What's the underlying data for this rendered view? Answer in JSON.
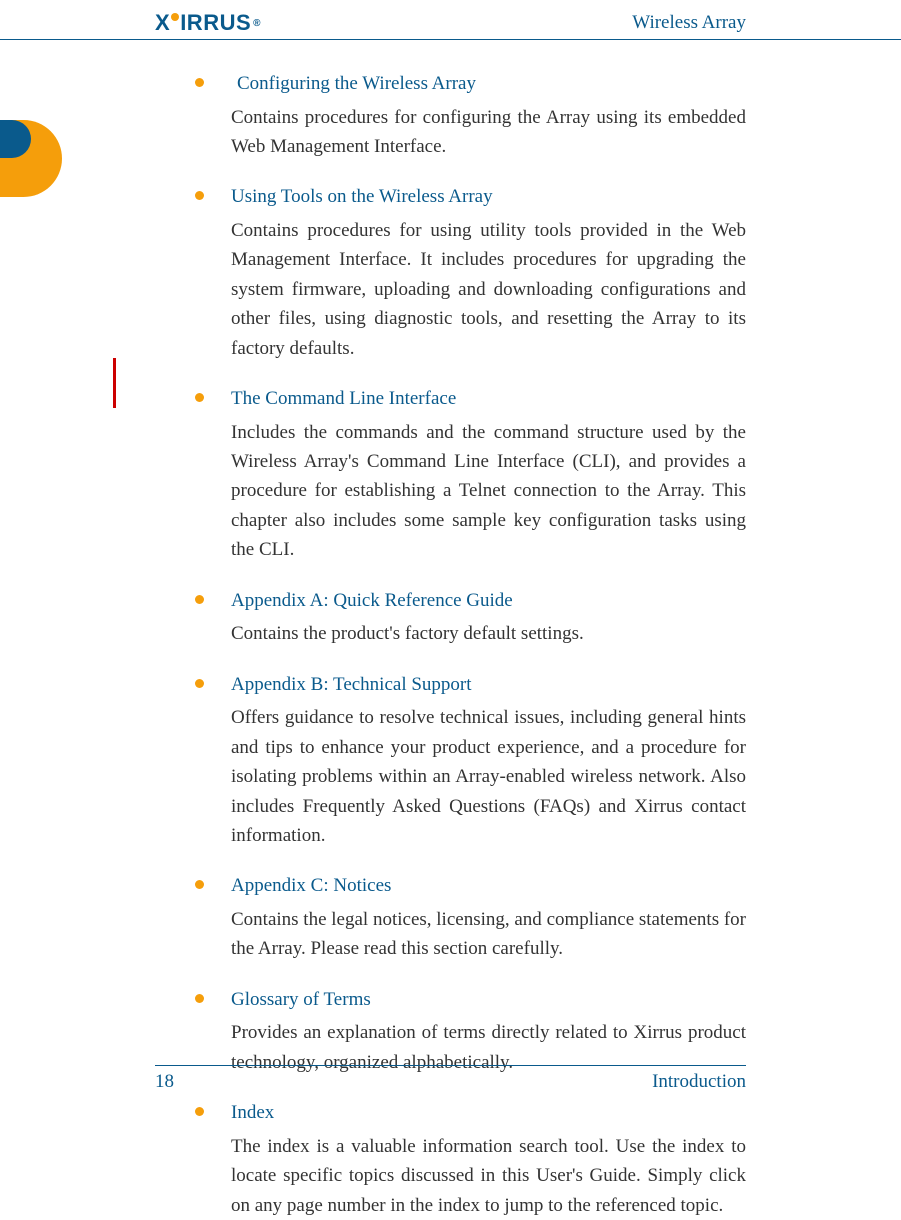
{
  "header": {
    "logo": "XIRRUS",
    "title": "Wireless Array"
  },
  "sections": [
    {
      "title": " Configuring the Wireless Array",
      "body": "Contains procedures for configuring the Array using its embedded Web Management Interface."
    },
    {
      "title": "Using Tools on the Wireless Array",
      "body": "Contains procedures for using utility tools provided in the Web Management Interface. It includes procedures for upgrading the system firmware, uploading and downloading configurations and other files, using diagnostic tools, and resetting the Array to its factory defaults."
    },
    {
      "title": "The Command Line Interface",
      "body": "Includes the commands and the command structure used by the Wireless Array's Command Line Interface (CLI), and provides a procedure for establishing a Telnet connection to the Array. This chapter also includes some sample key configuration tasks using the CLI."
    },
    {
      "title": "Appendix A: Quick Reference Guide",
      "body": "Contains the product's factory default settings."
    },
    {
      "title": "Appendix B: Technical Support",
      "body": "Offers guidance to resolve technical issues, including general hints and tips to enhance your product experience, and a procedure for isolating problems within an Array-enabled wireless network. Also includes Frequently Asked Questions (FAQs) and Xirrus contact information."
    },
    {
      "title": "Appendix C: Notices",
      "body": "Contains the legal notices, licensing, and compliance statements for the Array. Please read this section carefully."
    },
    {
      "title": "Glossary of Terms",
      "body": "Provides an explanation of terms directly related to Xirrus product technology, organized alphabetically."
    },
    {
      "title": "Index",
      "body": "The index is a valuable information search tool. Use the index to locate specific topics discussed in this User's Guide. Simply click on any page number in the index to jump to the referenced topic."
    }
  ],
  "footer": {
    "page": "18",
    "section": "Introduction"
  }
}
